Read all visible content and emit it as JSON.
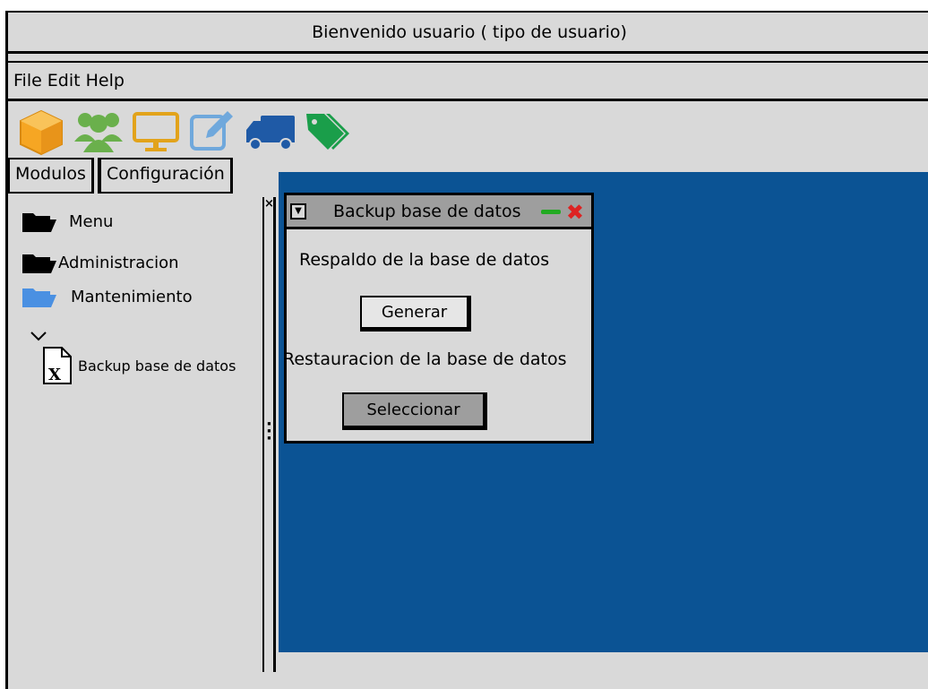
{
  "window": {
    "title": "Bienvenido usuario ( tipo de usuario)"
  },
  "menubar": {
    "items": [
      "File",
      "Edit",
      "Help"
    ]
  },
  "toolbar": {
    "icons": [
      "package-icon",
      "users-icon",
      "monitor-icon",
      "edit-icon",
      "truck-icon",
      "tag-icon"
    ],
    "colors": {
      "package": "#f6a623",
      "users": "#6ab04c",
      "monitor": "#e2a31b",
      "edit": "#6fa8dc",
      "truck": "#1f5aa6",
      "tag": "#1a9e4a"
    }
  },
  "tabs": [
    "Modulos",
    "Configuración"
  ],
  "tree": {
    "menu": "Menu",
    "administracion": "Administracion",
    "mantenimiento": "Mantenimiento",
    "backup": "Backup base de datos"
  },
  "dialog": {
    "title": "Backup base de datos",
    "respaldo_label": "Respaldo de la base de datos",
    "generar_button": "Generar",
    "restauracion_label": "Restauracion de la base de datos",
    "seleccionar_button": "Seleccionar"
  },
  "colors": {
    "desktop": "#0b5394",
    "background": "#d9d9d9",
    "close": "#dd2222",
    "minimize": "#22aa22"
  }
}
